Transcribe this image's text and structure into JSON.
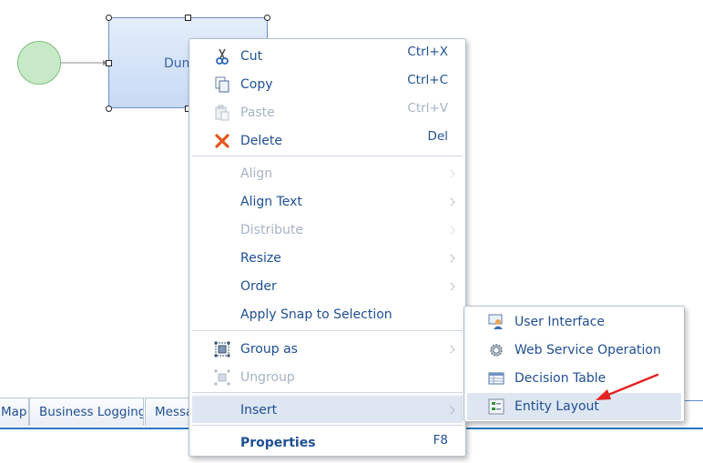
{
  "diagram": {
    "task_label": "Dum"
  },
  "tabs": [
    {
      "label": "Map"
    },
    {
      "label": "Business Logging"
    },
    {
      "label": "Messa"
    }
  ],
  "context_menu": {
    "items": [
      {
        "label": "Cut",
        "shortcut": "Ctrl+X",
        "icon": "scissors-icon",
        "enabled": true
      },
      {
        "label": "Copy",
        "shortcut": "Ctrl+C",
        "icon": "copy-icon",
        "enabled": true
      },
      {
        "label": "Paste",
        "shortcut": "Ctrl+V",
        "icon": "paste-icon",
        "enabled": false
      },
      {
        "label": "Delete",
        "shortcut": "Del",
        "icon": "delete-x-icon",
        "enabled": true
      },
      {
        "label": "Align",
        "submenu": true,
        "enabled": false
      },
      {
        "label": "Align Text",
        "submenu": true,
        "enabled": true
      },
      {
        "label": "Distribute",
        "submenu": true,
        "enabled": false
      },
      {
        "label": "Resize",
        "submenu": true,
        "enabled": true
      },
      {
        "label": "Order",
        "submenu": true,
        "enabled": true
      },
      {
        "label": "Apply Snap to Selection",
        "enabled": true
      },
      {
        "label": "Group as",
        "submenu": true,
        "icon": "group-icon",
        "enabled": true
      },
      {
        "label": "Ungroup",
        "icon": "ungroup-icon",
        "enabled": false
      },
      {
        "label": "Insert",
        "submenu": true,
        "enabled": true,
        "highlighted": true
      },
      {
        "label": "Properties",
        "shortcut": "F8",
        "enabled": true,
        "bold": true
      }
    ]
  },
  "insert_submenu": {
    "items": [
      {
        "label": "User Interface",
        "icon": "user-interface-icon"
      },
      {
        "label": "Web Service Operation",
        "icon": "gear-icon"
      },
      {
        "label": "Decision Table",
        "icon": "table-icon"
      },
      {
        "label": "Entity Layout",
        "icon": "entity-layout-icon",
        "highlighted": true
      }
    ]
  },
  "colors": {
    "menu_text": "#1f4f93",
    "disabled_text": "#a7b3c4",
    "highlight_bg": "#dde6f1",
    "callout_arrow": "#e52222"
  }
}
